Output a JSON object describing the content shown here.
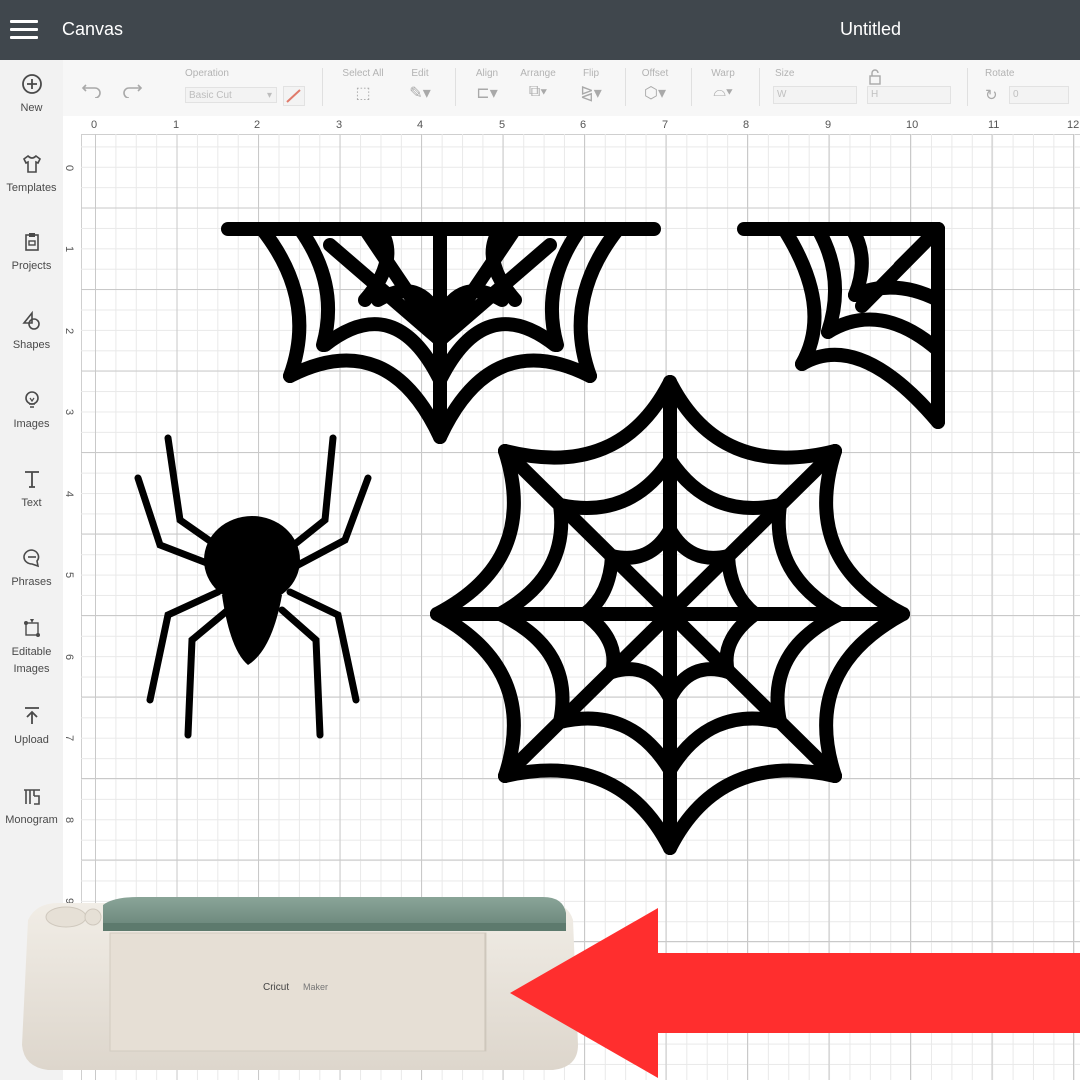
{
  "header": {
    "app_title": "Canvas",
    "document_title": "Untitled"
  },
  "sidebar": {
    "items": [
      {
        "label": "New",
        "icon": "plus-circle-icon"
      },
      {
        "label": "Templates",
        "icon": "shirt-icon"
      },
      {
        "label": "Projects",
        "icon": "clipboard-icon"
      },
      {
        "label": "Shapes",
        "icon": "shapes-icon"
      },
      {
        "label": "Images",
        "icon": "lightbulb-icon"
      },
      {
        "label": "Text",
        "icon": "text-icon"
      },
      {
        "label": "Phrases",
        "icon": "speech-bubble-icon"
      },
      {
        "label": "Editable Images",
        "icon": "editable-image-icon"
      },
      {
        "label": "Upload",
        "icon": "upload-icon"
      },
      {
        "label": "Monogram",
        "icon": "monogram-icon"
      }
    ]
  },
  "toolbar": {
    "operation_label": "Operation",
    "operation_value": "Basic Cut",
    "select_all_label": "Select All",
    "edit_label": "Edit",
    "align_label": "Align",
    "arrange_label": "Arrange",
    "flip_label": "Flip",
    "offset_label": "Offset",
    "warp_label": "Warp",
    "size_label": "Size",
    "width_label": "W",
    "height_label": "H",
    "rotate_label": "Rotate",
    "rotate_value": "0"
  },
  "ruler": {
    "top": [
      "0",
      "1",
      "2",
      "3",
      "4",
      "5",
      "6",
      "7",
      "8",
      "9",
      "10",
      "11",
      "12"
    ],
    "left": [
      "0",
      "1",
      "2",
      "3",
      "4",
      "5",
      "6",
      "7",
      "8",
      "9"
    ]
  },
  "machine": {
    "brand": "Cricut",
    "model": "Maker"
  },
  "colors": {
    "topbar": "#40474d",
    "arrow": "#ff2e2e",
    "machine_lid": "#7f9a8f"
  }
}
